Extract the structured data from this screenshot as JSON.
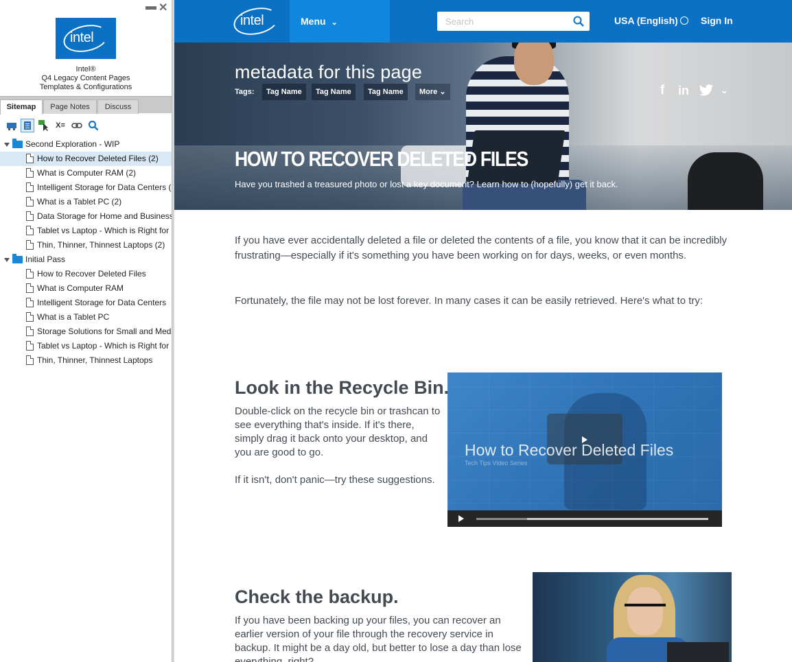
{
  "sidebar": {
    "project_name": "Intel®\nQ4 Legacy Content Pages\nTemplates & Configurations",
    "logo_text": "intel",
    "tabs": [
      {
        "label": "Sitemap",
        "active": true
      },
      {
        "label": "Page Notes",
        "active": false
      },
      {
        "label": "Discuss",
        "active": false
      }
    ],
    "toolbar_icons": [
      "map-icon",
      "page-list-icon",
      "pointer-icon",
      "variables-icon",
      "link-icon",
      "search-icon"
    ],
    "tree": [
      {
        "label": "Second Exploration - WIP",
        "type": "folder"
      },
      {
        "label": "How to Recover Deleted Files (2)",
        "type": "page",
        "selected": true
      },
      {
        "label": "What is Computer RAM (2)",
        "type": "page"
      },
      {
        "label": "Intelligent Storage for Data Centers (",
        "type": "page"
      },
      {
        "label": "What is a Tablet PC (2)",
        "type": "page"
      },
      {
        "label": "Data Storage for Home and Business",
        "type": "page"
      },
      {
        "label": "Tablet vs Laptop - Which is Right for",
        "type": "page"
      },
      {
        "label": "Thin, Thinner, Thinnest Laptops (2)",
        "type": "page"
      },
      {
        "label": "Initial Pass",
        "type": "folder"
      },
      {
        "label": "How to Recover Deleted Files",
        "type": "page"
      },
      {
        "label": "What is Computer RAM",
        "type": "page"
      },
      {
        "label": "Intelligent Storage for Data Centers",
        "type": "page"
      },
      {
        "label": "What is a Tablet PC",
        "type": "page"
      },
      {
        "label": "Storage Solutions for Small and Med",
        "type": "page"
      },
      {
        "label": "Tablet vs Laptop - Which is Right for",
        "type": "page"
      },
      {
        "label": "Thin, Thinner, Thinnest Laptops",
        "type": "page"
      }
    ]
  },
  "colors": {
    "brand_blue": "#0b71c5",
    "menu_blue": "#1186dd",
    "text": "#444a52"
  },
  "nav": {
    "logo_text": "intel",
    "menu_label": "Menu",
    "search_placeholder": "Search",
    "region_label": "USA (English)",
    "signin_label": "Sign In"
  },
  "hero": {
    "meta_title": "metadata for this page",
    "tags_label": "Tags:",
    "tags": [
      "Tag Name",
      "Tag Name",
      "Tag Name"
    ],
    "more_label": "More",
    "social_icons": [
      "facebook-icon",
      "linkedin-icon",
      "twitter-icon",
      "chevron-down-icon"
    ],
    "title": "HOW TO RECOVER DELETED FILES",
    "subtitle": "Have you trashed a treasured photo or lost a key document? Learn how to (hopefully) get it back."
  },
  "article": {
    "intro_1": "If you have ever accidentally deleted a file or deleted the contents of a file, you know that it can be incredibly frustrating—especially if it's something you have been working on for days, weeks, or even months.",
    "intro_2": "Fortunately, the file may not be lost forever. In many cases it can be easily retrieved. Here's what to try:",
    "section_1": {
      "heading": "Look in the Recycle Bin.",
      "p1": "Double-click on the recycle bin or trashcan to see everything that's inside. If it's there, simply drag it back onto your desktop, and you are good to go.",
      "p2": "If it isn't, don't panic—try these suggestions."
    },
    "video": {
      "title": "How to Recover Deleted Files",
      "subtitle": "Tech Tips Video Series",
      "buffered_fraction": 0.22
    },
    "section_2": {
      "heading": "Check the backup.",
      "p": "If you have been backing up your files, you can recover an earlier version of your file through the recovery service in backup. It might be a day old, but better to lose a day than lose everything, right?"
    }
  }
}
